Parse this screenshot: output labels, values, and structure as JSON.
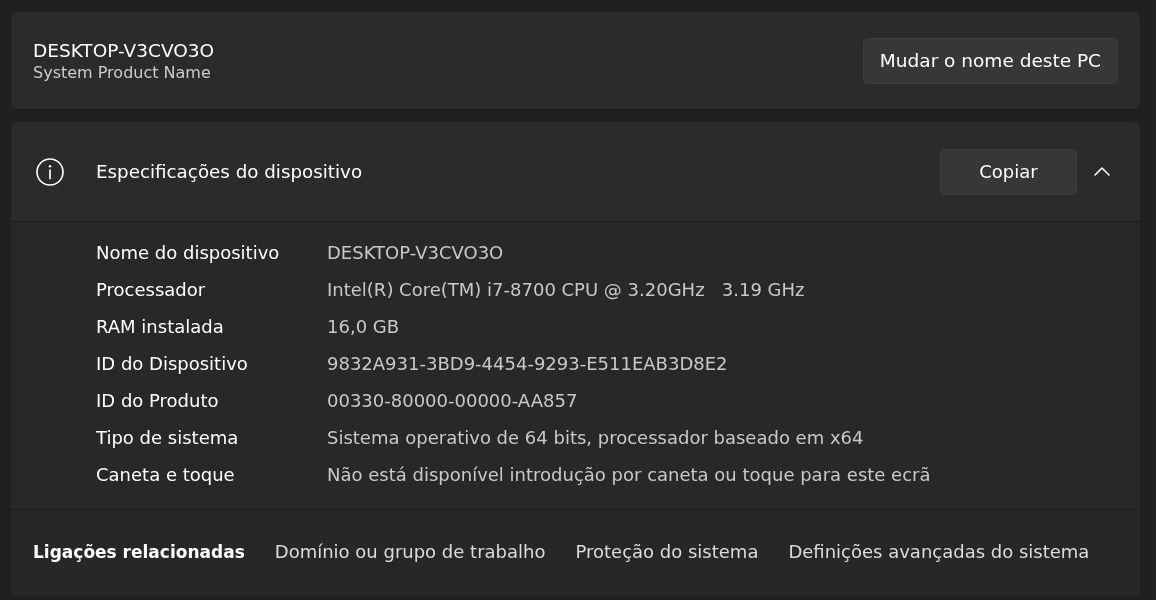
{
  "device_card": {
    "name": "DESKTOP-V3CVO3O",
    "model": "System Product Name",
    "rename_button": "Mudar o nome deste PC"
  },
  "specifications": {
    "title": "Especificações do dispositivo",
    "copy_button": "Copiar",
    "expanded": true,
    "rows": [
      {
        "label": "Nome do dispositivo",
        "value": "DESKTOP-V3CVO3O"
      },
      {
        "label": "Processador",
        "value": "Intel(R) Core(TM) i7-8700 CPU @ 3.20GHz   3.19 GHz"
      },
      {
        "label": "RAM instalada",
        "value": "16,0 GB"
      },
      {
        "label": "ID do Dispositivo",
        "value": "9832A931-3BD9-4454-9293-E511EAB3D8E2"
      },
      {
        "label": "ID do Produto",
        "value": "00330-80000-00000-AA857"
      },
      {
        "label": "Tipo de sistema",
        "value": "Sistema operativo de 64 bits, processador baseado em x64"
      },
      {
        "label": "Caneta e toque",
        "value": "Não está disponível introdução por caneta ou toque para este ecrã"
      }
    ]
  },
  "related_links": {
    "title": "Ligações relacionadas",
    "links": [
      "Domínio ou grupo de trabalho",
      "Proteção do sistema",
      "Definições avançadas do sistema"
    ]
  }
}
